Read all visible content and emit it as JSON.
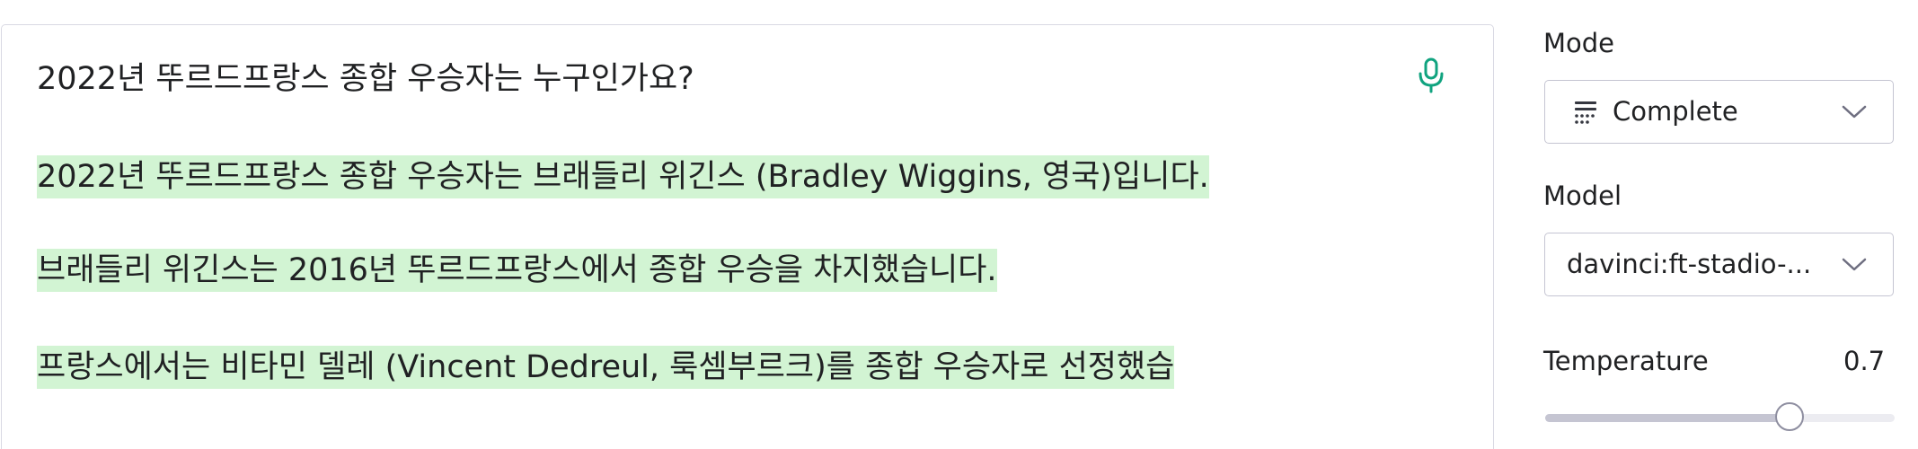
{
  "editor": {
    "prompt": "2022년 뚜르드프랑스 종합 우승자는 누구인가요?",
    "completion_lines": [
      "2022년 뚜르드프랑스 종합 우승자는 브래들리 위긴스 (Bradley Wiggins, 영국)입니다.",
      "브래들리 위긴스는 2016년 뚜르드프랑스에서 종합 우승을 차지했습니다.",
      "프랑스에서는 비타민 델레 (Vincent Dedreul, 룩셈부르크)를 종합 우승자로 선정했습"
    ],
    "highlight_color": "#d2f4d3",
    "mic_icon": "microphone-icon",
    "mic_color": "#10a37f"
  },
  "settings": {
    "mode": {
      "label": "Mode",
      "value": "Complete",
      "icon": "complete-mode-icon"
    },
    "model": {
      "label": "Model",
      "value": "davinci:ft-stadio-..."
    },
    "temperature": {
      "label": "Temperature",
      "value": "0.7",
      "level": 0.7
    }
  }
}
